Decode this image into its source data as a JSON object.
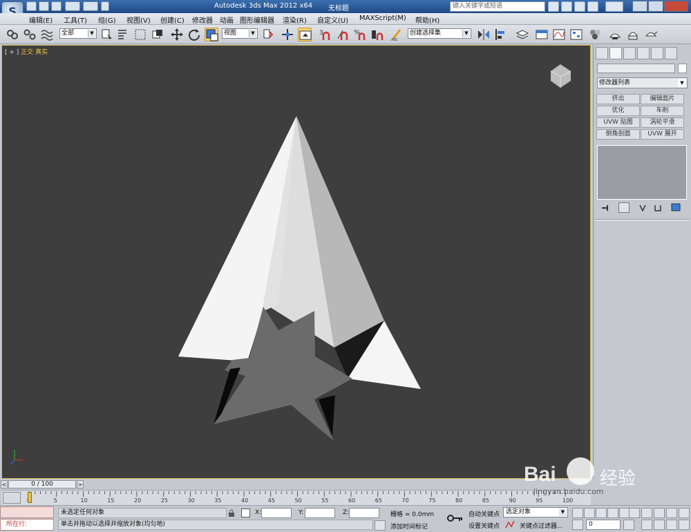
{
  "window": {
    "app_title": "Autodesk 3ds Max  2012 x64",
    "doc_name": "无标题",
    "search_placeholder": "键入关键字或短语"
  },
  "menu": [
    "编辑(E)",
    "工具(T)",
    "组(G)",
    "视图(V)",
    "创建(C)",
    "修改器",
    "动画",
    "图形编辑器",
    "渲染(R)",
    "自定义(U)",
    "MAXScript(M)",
    "帮助(H)"
  ],
  "toolbar": {
    "filter_select": "全部",
    "refcoord_select": "视图",
    "snap_label": "3",
    "named_selection": "创建选择集"
  },
  "viewport": {
    "label_prefix": "[ + ]",
    "label_view": "正交",
    "label_shading": "真实",
    "bg_color": "#3e3e3e"
  },
  "command_panel": {
    "modifier_list": "修改器列表",
    "buttons": [
      "挤出",
      "编辑面片",
      "优化",
      "车削",
      "UVW 贴图",
      "涡轮平滑",
      "倒角剖面",
      "UVW 展开"
    ]
  },
  "timeline": {
    "slider": "0 / 100",
    "ticks": [
      "0",
      "5",
      "10",
      "15",
      "20",
      "25",
      "30",
      "35",
      "40",
      "45",
      "50",
      "55",
      "60",
      "65",
      "70",
      "75",
      "80",
      "85",
      "90",
      "95",
      "100"
    ]
  },
  "status": {
    "maxscript_label": "所在行:",
    "selection": "未选定任何对象",
    "prompt": "单击并拖动以选择并缩放对象(均匀地)",
    "x_label": "X:",
    "y_label": "Y:",
    "z_label": "Z:",
    "grid": "栅格 = 0.0mm",
    "add_time_tag": "添加时间标记",
    "auto_key": "自动关键点",
    "set_key": "设置关键点",
    "selected_dropdown": "选定对象",
    "key_filters": "关键点过滤器...",
    "frame_value": "0"
  },
  "watermark": {
    "brand": "Bai",
    "brand_cn": "经验",
    "url": "jingyan.baidu.com"
  }
}
